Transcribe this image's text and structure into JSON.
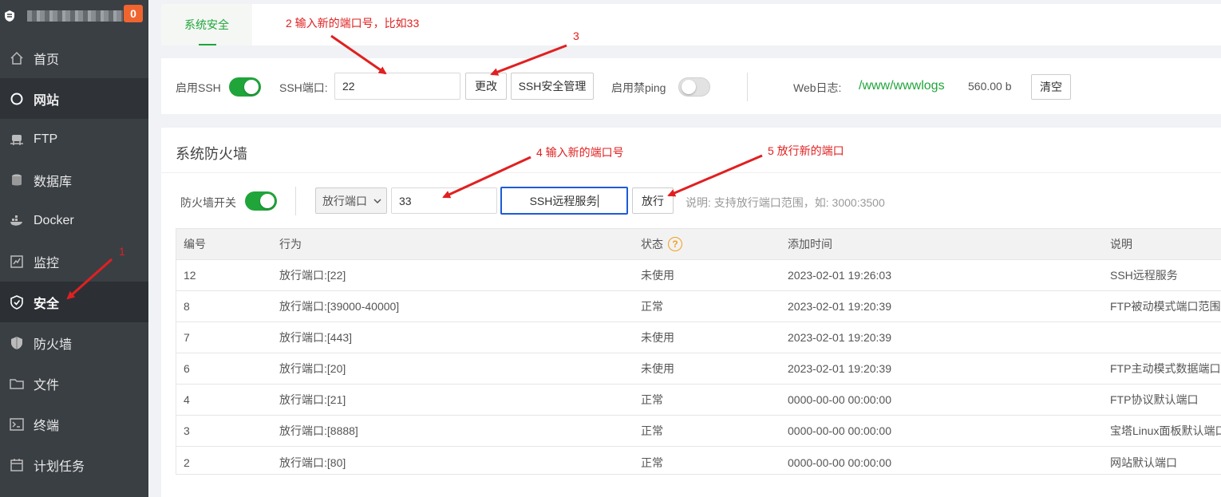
{
  "sidebar": {
    "badge": "0",
    "items": [
      {
        "label": "首页",
        "icon": "home-icon"
      },
      {
        "label": "网站",
        "icon": "globe-icon"
      },
      {
        "label": "FTP",
        "icon": "ftp-icon"
      },
      {
        "label": "数据库",
        "icon": "database-icon"
      },
      {
        "label": "Docker",
        "icon": "docker-icon"
      },
      {
        "label": "监控",
        "icon": "monitor-icon"
      },
      {
        "label": "安全",
        "icon": "shield-check-icon"
      },
      {
        "label": "防火墙",
        "icon": "shield-icon"
      },
      {
        "label": "文件",
        "icon": "folder-icon"
      },
      {
        "label": "终端",
        "icon": "terminal-icon"
      },
      {
        "label": "计划任务",
        "icon": "calendar-icon"
      }
    ]
  },
  "tabs": {
    "active": "系统安全"
  },
  "ssh": {
    "enable_label": "启用SSH",
    "enabled": true,
    "port_label": "SSH端口:",
    "port_value": "22",
    "change_button": "更改",
    "manage_button": "SSH安全管理",
    "ping_label": "启用禁ping",
    "ping_enabled": false,
    "weblog_label": "Web日志:",
    "weblog_path": "/www/wwwlogs",
    "weblog_size": "560.00 b",
    "clear_button": "清空"
  },
  "firewall": {
    "title": "系统防火墙",
    "switch_label": "防火墙开关",
    "enabled": true,
    "mode_select": "放行端口",
    "port_value": "33",
    "note_value": "SSH远程服务",
    "allow_button": "放行",
    "hint": "说明: 支持放行端口范围，如: 3000:3500",
    "columns": [
      "编号",
      "行为",
      "状态",
      "添加时间",
      "说明"
    ],
    "rows": [
      {
        "id": "12",
        "action": "放行端口:[22]",
        "status": "未使用",
        "time": "2023-02-01 19:26:03",
        "note": "SSH远程服务"
      },
      {
        "id": "8",
        "action": "放行端口:[39000-40000]",
        "status": "正常",
        "time": "2023-02-01 19:20:39",
        "note": "FTP被动模式端口范围"
      },
      {
        "id": "7",
        "action": "放行端口:[443]",
        "status": "未使用",
        "time": "2023-02-01 19:20:39",
        "note": ""
      },
      {
        "id": "6",
        "action": "放行端口:[20]",
        "status": "未使用",
        "time": "2023-02-01 19:20:39",
        "note": "FTP主动模式数据端口"
      },
      {
        "id": "4",
        "action": "放行端口:[21]",
        "status": "正常",
        "time": "0000-00-00 00:00:00",
        "note": "FTP协议默认端口"
      },
      {
        "id": "3",
        "action": "放行端口:[8888]",
        "status": "正常",
        "time": "0000-00-00 00:00:00",
        "note": "宝塔Linux面板默认端口"
      },
      {
        "id": "2",
        "action": "放行端口:[80]",
        "status": "正常",
        "time": "0000-00-00 00:00:00",
        "note": "网站默认端口"
      }
    ]
  },
  "annotations": {
    "a1": "1",
    "a2": "2 输入新的端口号，比如33",
    "a3": "3",
    "a4": "4  输入新的端口号",
    "a5": "5 放行新的端口",
    "color": "#e02020"
  },
  "colors": {
    "accent": "#20a53a",
    "sidebar": "#3a3f44",
    "badge": "#f0652f"
  }
}
